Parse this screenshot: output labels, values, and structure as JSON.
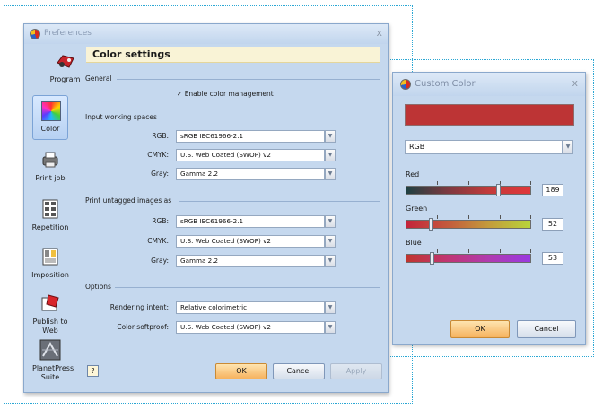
{
  "preferences": {
    "title": "Preferences",
    "close": "x",
    "nav": [
      {
        "label": "Program",
        "icon": "program-icon"
      },
      {
        "label": "Color",
        "icon": "color-icon"
      },
      {
        "label": "Print job",
        "icon": "printer-icon"
      },
      {
        "label": "Repetition",
        "icon": "repetition-icon"
      },
      {
        "label": "Imposition",
        "icon": "imposition-icon"
      },
      {
        "label": "Publish to Web",
        "icon": "publish-icon"
      },
      {
        "label": "PlanetPress Suite",
        "icon": "planetpress-icon"
      }
    ],
    "active_nav": "Color",
    "section_title": "Color settings",
    "general": {
      "heading": "General",
      "enable_label": "Enable color management",
      "enable_checked": true
    },
    "input_spaces": {
      "heading": "Input working spaces",
      "rgb": {
        "label": "RGB:",
        "value": "sRGB IEC61966-2.1"
      },
      "cmyk": {
        "label": "CMYK:",
        "value": "U.S. Web Coated (SWOP) v2"
      },
      "gray": {
        "label": "Gray:",
        "value": "Gamma 2.2"
      }
    },
    "untagged": {
      "heading": "Print untagged images as",
      "rgb": {
        "label": "RGB:",
        "value": "sRGB IEC61966-2.1"
      },
      "cmyk": {
        "label": "CMYK:",
        "value": "U.S. Web Coated (SWOP) v2"
      },
      "gray": {
        "label": "Gray:",
        "value": "Gamma 2.2"
      }
    },
    "options": {
      "heading": "Options",
      "intent": {
        "label": "Rendering intent:",
        "value": "Relative colorimetric"
      },
      "softproof": {
        "label": "Color softproof:",
        "value": "U.S. Web Coated (SWOP) v2"
      }
    },
    "buttons": {
      "help": "?",
      "ok": "OK",
      "cancel": "Cancel",
      "apply": "Apply"
    }
  },
  "custom_color": {
    "title": "Custom Color",
    "close": "x",
    "swatch_color": "#bd3435",
    "mode": "RGB",
    "channels": [
      {
        "name": "Red",
        "value": "189",
        "fraction": 0.741
      },
      {
        "name": "Green",
        "value": "52",
        "fraction": 0.204
      },
      {
        "name": "Blue",
        "value": "53",
        "fraction": 0.208
      }
    ],
    "buttons": {
      "ok": "OK",
      "cancel": "Cancel"
    }
  },
  "colors": {
    "accent_dotted": "#2aa7d4",
    "window_body": "#c5d8ee",
    "header_bar": "#f9f3d6",
    "ok_button": "#f6b25e"
  }
}
